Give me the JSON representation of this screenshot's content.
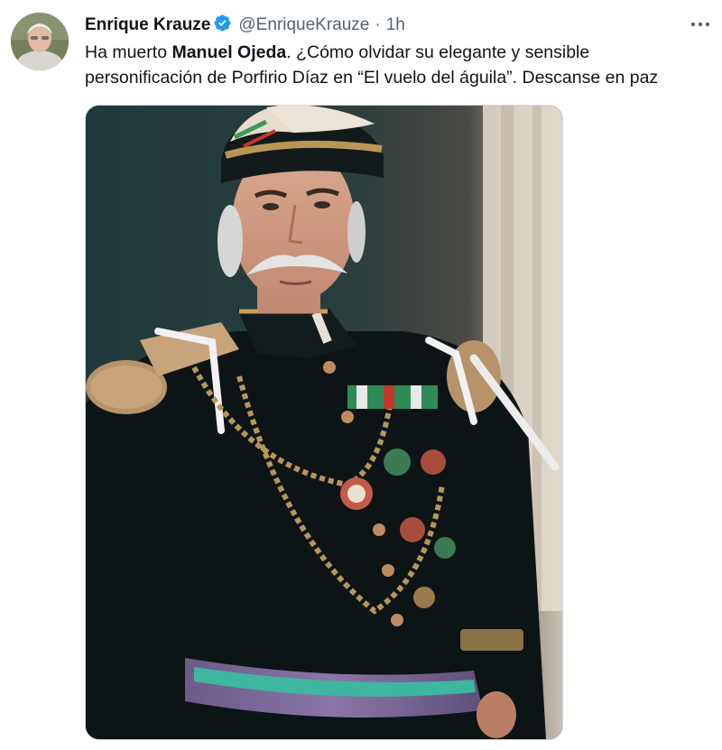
{
  "author": {
    "display_name": "Enrique Krauze",
    "handle": "@EnriqueKrauze",
    "separator": "·",
    "time": "1h",
    "verified": true
  },
  "tweet": {
    "text_part1": "Ha muerto ",
    "text_bold": "Manuel Ojeda",
    "text_part2": ". ¿Cómo olvidar su elegante y sensible personificación de Porfirio Díaz en “El vuelo del águila”. Descanse en paz"
  },
  "media": {
    "type": "photo"
  },
  "icons": {
    "more": "more-options-icon",
    "verified": "verified-badge-icon"
  },
  "colors": {
    "verified_blue": "#1d9bf0",
    "secondary_text": "#536471",
    "primary_text": "#0f1419"
  }
}
